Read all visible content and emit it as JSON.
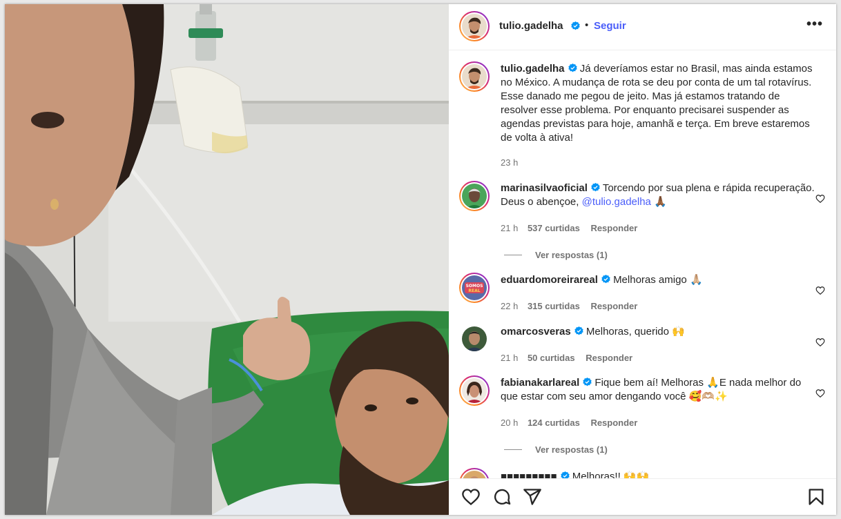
{
  "post": {
    "author": "tulio.gadelha",
    "follow_label": "Seguir",
    "dot": "•",
    "more_label": "•••",
    "caption": "Já deveríamos estar no Brasil, mas ainda estamos no México. A mudança de rota se deu por conta de um tal rotavírus. Esse danado me pegou de jeito. Mas já estamos tratando de resolver esse problema. Por enquanto precisarei suspender as agendas previstas para hoje, amanhã e terça. Em breve estaremos de volta à ativa!",
    "time": "23 h"
  },
  "comments": [
    {
      "user": "marinasilvaoficial",
      "text": "Torcendo por sua plena e rápida recuperação. Deus o abençoe,",
      "mention": "@tulio.gadelha",
      "emoji": "🙏🏾",
      "time": "21 h",
      "likes": "537 curtidas",
      "reply": "Responder",
      "view_replies": "Ver respostas (1)"
    },
    {
      "user": "eduardomoreirareal",
      "text": "Melhoras amigo 🙏🏼",
      "time": "22 h",
      "likes": "315 curtidas",
      "reply": "Responder"
    },
    {
      "user": "omarcosveras",
      "text": "Melhoras, querido 🙌",
      "time": "21 h",
      "likes": "50 curtidas",
      "reply": "Responder"
    },
    {
      "user": "fabianakarlareal",
      "text": "Fique bem aí! Melhoras 🙏E nada melhor do que estar com seu amor dengando você 🥰🫶🏼✨",
      "time": "20 h",
      "likes": "124 curtidas",
      "reply": "Responder",
      "view_replies": "Ver respostas (1)"
    }
  ],
  "partial_comment": {
    "text": "Melhoras!! 🙌🙌"
  },
  "icons": {
    "like": "heart-icon",
    "comment": "comment-icon",
    "share": "send-icon",
    "save": "bookmark-icon",
    "verified": "verified-badge-icon"
  },
  "colors": {
    "link": "#4a5df9",
    "verified": "#0095f6",
    "secondary_text": "#737373"
  }
}
